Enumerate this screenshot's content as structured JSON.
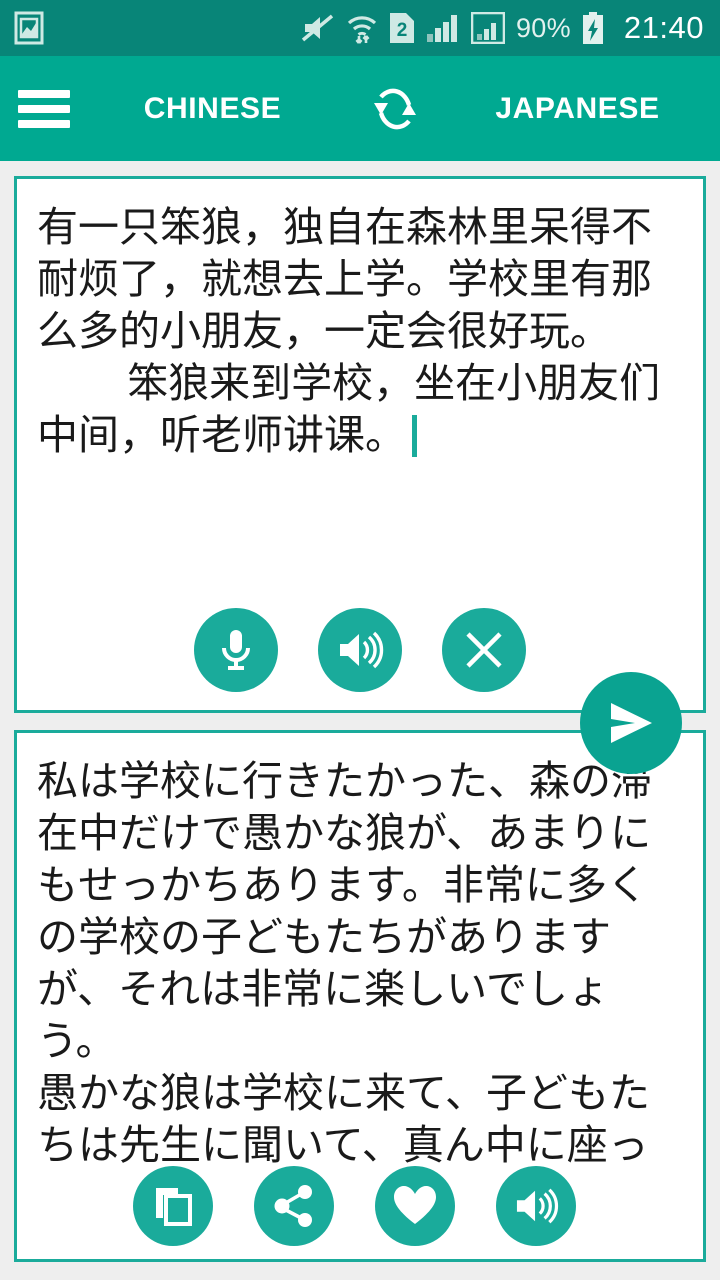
{
  "status_bar": {
    "notification_icon": "image-icon",
    "icons": [
      "sound-muted-icon",
      "wifi-icon",
      "sim-2-icon",
      "signal-1-icon",
      "signal-2-icon"
    ],
    "sim_label": "2",
    "battery_percent": "90%",
    "battery_state": "charging-icon",
    "time": "21:40",
    "background_color": "#088578"
  },
  "app_bar": {
    "menu_icon": "hamburger-menu-icon",
    "source_language": "CHINESE",
    "swap_icon": "swap-languages-icon",
    "target_language": "JAPANESE",
    "background_color": "#00a991"
  },
  "source_card": {
    "lines": [
      "有一只笨狼，独自在森林里呆得不耐烦了，就想去上学。学校里有那么多的小朋友，一定会很好玩。",
      "笨狼来到学校，坐在小朋友们中间，听老师讲课。"
    ],
    "caret_visible": true,
    "buttons": [
      {
        "name": "microphone-button",
        "icon": "microphone-icon"
      },
      {
        "name": "speak-source-button",
        "icon": "speaker-icon"
      },
      {
        "name": "clear-text-button",
        "icon": "close-x-icon"
      }
    ]
  },
  "send_button": {
    "name": "send-button",
    "icon": "send-paper-plane-icon"
  },
  "target_card": {
    "lines": [
      "私は学校に行きたかった、森の滞在中だけで愚かな狼が、あまりにもせっかちあります。非常に多くの学校の子どもたちがありますが、それは非常に楽しいでしょう。",
      "愚かな狼は学校に来て、子どもたちは先生に聞いて、真ん中に座っ"
    ],
    "buttons": [
      {
        "name": "copy-button",
        "icon": "copy-icon"
      },
      {
        "name": "share-button",
        "icon": "share-icon"
      },
      {
        "name": "favorite-button",
        "icon": "heart-icon"
      },
      {
        "name": "speak-translation-button",
        "icon": "speaker-icon"
      }
    ]
  },
  "theme": {
    "accent": "#1aab9b",
    "header": "#00a991",
    "status_bar": "#088578",
    "page_background": "#eeeeee",
    "card_background": "#ffffff"
  }
}
